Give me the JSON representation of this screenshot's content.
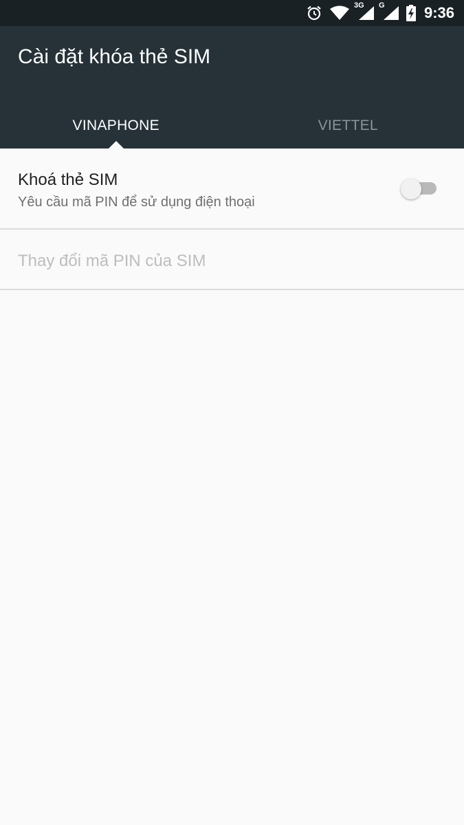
{
  "status_bar": {
    "time": "9:36",
    "net1": "3G",
    "net2": "G",
    "icons": [
      "alarm-icon",
      "wifi-icon",
      "signal-3g-icon",
      "signal-g-icon",
      "battery-charging-icon"
    ]
  },
  "header": {
    "title": "Cài đặt khóa thẻ SIM",
    "tabs": [
      {
        "label": "VINAPHONE",
        "active": true
      },
      {
        "label": "VIETTEL",
        "active": false
      }
    ]
  },
  "settings": {
    "sim_lock": {
      "title": "Khoá thẻ SIM",
      "summary": "Yêu cầu mã PIN để sử dụng điện thoại",
      "enabled": false
    },
    "change_pin": {
      "title": "Thay đổi mã PIN của SIM",
      "enabled": false
    }
  },
  "colors": {
    "status_bar": "#1a2125",
    "app_bar": "#263238",
    "background": "#fafafa",
    "active_tab": "#ffffff",
    "inactive_tab": "#8a959b"
  }
}
